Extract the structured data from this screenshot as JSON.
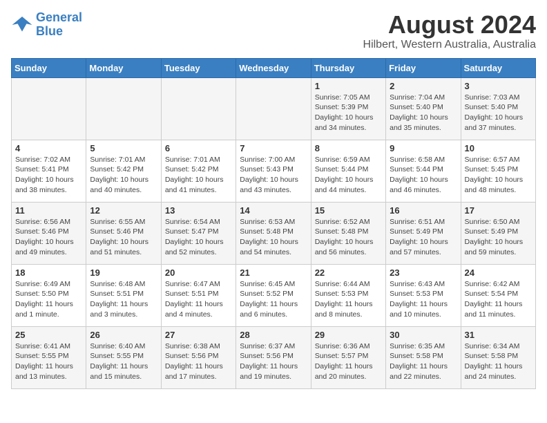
{
  "header": {
    "logo": {
      "line1": "General",
      "line2": "Blue"
    },
    "title": "August 2024",
    "subtitle": "Hilbert, Western Australia, Australia"
  },
  "days_of_week": [
    "Sunday",
    "Monday",
    "Tuesday",
    "Wednesday",
    "Thursday",
    "Friday",
    "Saturday"
  ],
  "weeks": [
    [
      {
        "day": "",
        "content": ""
      },
      {
        "day": "",
        "content": ""
      },
      {
        "day": "",
        "content": ""
      },
      {
        "day": "",
        "content": ""
      },
      {
        "day": "1",
        "content": "Sunrise: 7:05 AM\nSunset: 5:39 PM\nDaylight: 10 hours\nand 34 minutes."
      },
      {
        "day": "2",
        "content": "Sunrise: 7:04 AM\nSunset: 5:40 PM\nDaylight: 10 hours\nand 35 minutes."
      },
      {
        "day": "3",
        "content": "Sunrise: 7:03 AM\nSunset: 5:40 PM\nDaylight: 10 hours\nand 37 minutes."
      }
    ],
    [
      {
        "day": "4",
        "content": "Sunrise: 7:02 AM\nSunset: 5:41 PM\nDaylight: 10 hours\nand 38 minutes."
      },
      {
        "day": "5",
        "content": "Sunrise: 7:01 AM\nSunset: 5:42 PM\nDaylight: 10 hours\nand 40 minutes."
      },
      {
        "day": "6",
        "content": "Sunrise: 7:01 AM\nSunset: 5:42 PM\nDaylight: 10 hours\nand 41 minutes."
      },
      {
        "day": "7",
        "content": "Sunrise: 7:00 AM\nSunset: 5:43 PM\nDaylight: 10 hours\nand 43 minutes."
      },
      {
        "day": "8",
        "content": "Sunrise: 6:59 AM\nSunset: 5:44 PM\nDaylight: 10 hours\nand 44 minutes."
      },
      {
        "day": "9",
        "content": "Sunrise: 6:58 AM\nSunset: 5:44 PM\nDaylight: 10 hours\nand 46 minutes."
      },
      {
        "day": "10",
        "content": "Sunrise: 6:57 AM\nSunset: 5:45 PM\nDaylight: 10 hours\nand 48 minutes."
      }
    ],
    [
      {
        "day": "11",
        "content": "Sunrise: 6:56 AM\nSunset: 5:46 PM\nDaylight: 10 hours\nand 49 minutes."
      },
      {
        "day": "12",
        "content": "Sunrise: 6:55 AM\nSunset: 5:46 PM\nDaylight: 10 hours\nand 51 minutes."
      },
      {
        "day": "13",
        "content": "Sunrise: 6:54 AM\nSunset: 5:47 PM\nDaylight: 10 hours\nand 52 minutes."
      },
      {
        "day": "14",
        "content": "Sunrise: 6:53 AM\nSunset: 5:48 PM\nDaylight: 10 hours\nand 54 minutes."
      },
      {
        "day": "15",
        "content": "Sunrise: 6:52 AM\nSunset: 5:48 PM\nDaylight: 10 hours\nand 56 minutes."
      },
      {
        "day": "16",
        "content": "Sunrise: 6:51 AM\nSunset: 5:49 PM\nDaylight: 10 hours\nand 57 minutes."
      },
      {
        "day": "17",
        "content": "Sunrise: 6:50 AM\nSunset: 5:49 PM\nDaylight: 10 hours\nand 59 minutes."
      }
    ],
    [
      {
        "day": "18",
        "content": "Sunrise: 6:49 AM\nSunset: 5:50 PM\nDaylight: 11 hours\nand 1 minute."
      },
      {
        "day": "19",
        "content": "Sunrise: 6:48 AM\nSunset: 5:51 PM\nDaylight: 11 hours\nand 3 minutes."
      },
      {
        "day": "20",
        "content": "Sunrise: 6:47 AM\nSunset: 5:51 PM\nDaylight: 11 hours\nand 4 minutes."
      },
      {
        "day": "21",
        "content": "Sunrise: 6:45 AM\nSunset: 5:52 PM\nDaylight: 11 hours\nand 6 minutes."
      },
      {
        "day": "22",
        "content": "Sunrise: 6:44 AM\nSunset: 5:53 PM\nDaylight: 11 hours\nand 8 minutes."
      },
      {
        "day": "23",
        "content": "Sunrise: 6:43 AM\nSunset: 5:53 PM\nDaylight: 11 hours\nand 10 minutes."
      },
      {
        "day": "24",
        "content": "Sunrise: 6:42 AM\nSunset: 5:54 PM\nDaylight: 11 hours\nand 11 minutes."
      }
    ],
    [
      {
        "day": "25",
        "content": "Sunrise: 6:41 AM\nSunset: 5:55 PM\nDaylight: 11 hours\nand 13 minutes."
      },
      {
        "day": "26",
        "content": "Sunrise: 6:40 AM\nSunset: 5:55 PM\nDaylight: 11 hours\nand 15 minutes."
      },
      {
        "day": "27",
        "content": "Sunrise: 6:38 AM\nSunset: 5:56 PM\nDaylight: 11 hours\nand 17 minutes."
      },
      {
        "day": "28",
        "content": "Sunrise: 6:37 AM\nSunset: 5:56 PM\nDaylight: 11 hours\nand 19 minutes."
      },
      {
        "day": "29",
        "content": "Sunrise: 6:36 AM\nSunset: 5:57 PM\nDaylight: 11 hours\nand 20 minutes."
      },
      {
        "day": "30",
        "content": "Sunrise: 6:35 AM\nSunset: 5:58 PM\nDaylight: 11 hours\nand 22 minutes."
      },
      {
        "day": "31",
        "content": "Sunrise: 6:34 AM\nSunset: 5:58 PM\nDaylight: 11 hours\nand 24 minutes."
      }
    ]
  ]
}
